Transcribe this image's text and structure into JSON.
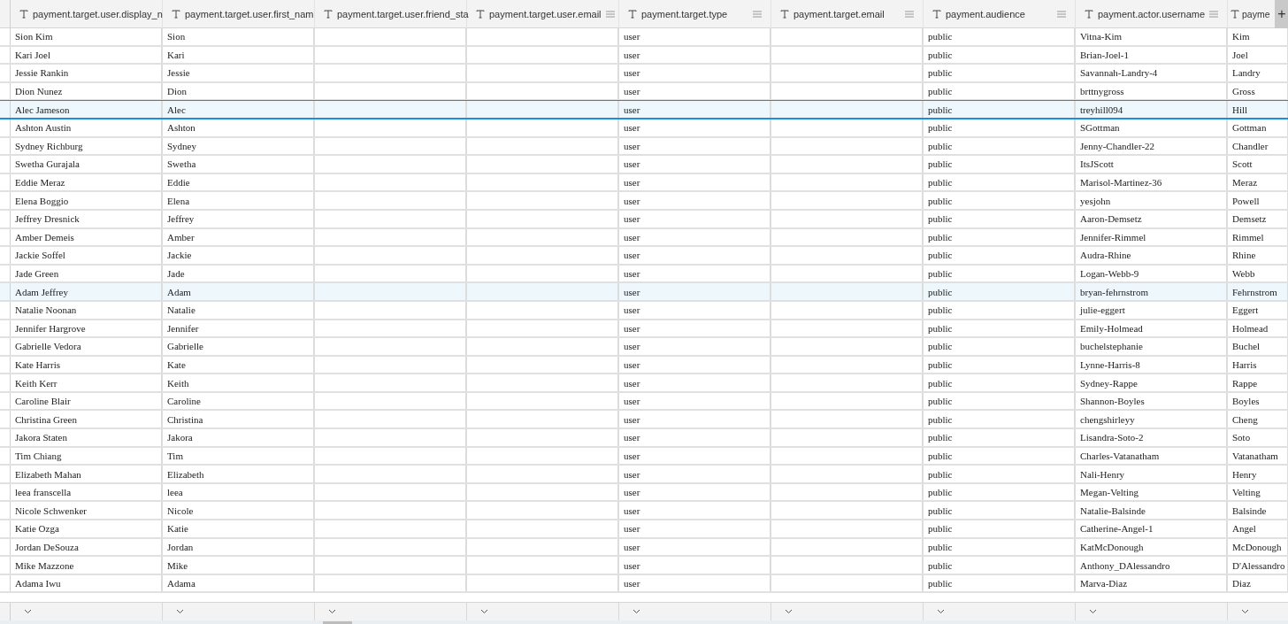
{
  "table": {
    "columns": [
      {
        "label": "payment.target.user.display_n"
      },
      {
        "label": "payment.target.user.first_nam"
      },
      {
        "label": "payment.target.user.friend_sta"
      },
      {
        "label": "payment.target.user.email",
        "menu": true
      },
      {
        "label": "payment.target.type",
        "menu": true
      },
      {
        "label": "payment.target.email",
        "menu": true
      },
      {
        "label": "payment.audience",
        "menu": true
      },
      {
        "label": "payment.actor.username",
        "menu": true
      },
      {
        "label": "payme"
      }
    ],
    "add_column": {
      "label": "+"
    },
    "rows": [
      {
        "display_name": "Sion Kim",
        "first_name": "Sion",
        "target_type": "user",
        "audience": "public",
        "actor_username": "Vitna-Kim",
        "column_9": "Kim",
        "selected": false,
        "highlighted": false
      },
      {
        "display_name": "Kari Joel",
        "first_name": "Kari",
        "target_type": "user",
        "audience": "public",
        "actor_username": "Brian-Joel-1",
        "column_9": "Joel",
        "selected": false,
        "highlighted": false
      },
      {
        "display_name": "Jessie Rankin",
        "first_name": "Jessie",
        "target_type": "user",
        "audience": "public",
        "actor_username": "Savannah-Landry-4",
        "column_9": "Landry",
        "selected": false,
        "highlighted": false
      },
      {
        "display_name": "Dion Nunez",
        "first_name": "Dion",
        "target_type": "user",
        "audience": "public",
        "actor_username": "brttnygross",
        "column_9": "Gross",
        "selected": false,
        "highlighted": false
      },
      {
        "display_name": "Alec Jameson",
        "first_name": "Alec",
        "target_type": "user",
        "audience": "public",
        "actor_username": "treyhill094",
        "column_9": "Hill",
        "selected": true,
        "highlighted": true
      },
      {
        "display_name": "Ashton Austin",
        "first_name": "Ashton",
        "target_type": "user",
        "audience": "public",
        "actor_username": "SGottman",
        "column_9": "Gottman",
        "selected": false,
        "highlighted": false
      },
      {
        "display_name": "Sydney Richburg",
        "first_name": "Sydney",
        "target_type": "user",
        "audience": "public",
        "actor_username": "Jenny-Chandler-22",
        "column_9": "Chandler",
        "selected": false,
        "highlighted": false
      },
      {
        "display_name": "Swetha Gurajala",
        "first_name": "Swetha",
        "target_type": "user",
        "audience": "public",
        "actor_username": "ItsJScott",
        "column_9": "Scott",
        "selected": false,
        "highlighted": false
      },
      {
        "display_name": "Eddie Meraz",
        "first_name": "Eddie",
        "target_type": "user",
        "audience": "public",
        "actor_username": "Marisol-Martinez-36",
        "column_9": "Meraz",
        "selected": false,
        "highlighted": false
      },
      {
        "display_name": "Elena Boggio",
        "first_name": "Elena",
        "target_type": "user",
        "audience": "public",
        "actor_username": "yesjohn",
        "column_9": "Powell",
        "selected": false,
        "highlighted": false
      },
      {
        "display_name": "Jeffrey Dresnick",
        "first_name": "Jeffrey",
        "target_type": "user",
        "audience": "public",
        "actor_username": "Aaron-Demsetz",
        "column_9": "Demsetz",
        "selected": false,
        "highlighted": false
      },
      {
        "display_name": "Amber Demeis",
        "first_name": "Amber",
        "target_type": "user",
        "audience": "public",
        "actor_username": "Jennifer-Rimmel",
        "column_9": "Rimmel",
        "selected": false,
        "highlighted": false
      },
      {
        "display_name": "Jackie Soffel",
        "first_name": "Jackie",
        "target_type": "user",
        "audience": "public",
        "actor_username": "Audra-Rhine",
        "column_9": "Rhine",
        "selected": false,
        "highlighted": false
      },
      {
        "display_name": "Jade Green",
        "first_name": "Jade",
        "target_type": "user",
        "audience": "public",
        "actor_username": "Logan-Webb-9",
        "column_9": "Webb",
        "selected": false,
        "highlighted": false
      },
      {
        "display_name": "Adam Jeffrey",
        "first_name": "Adam",
        "target_type": "user",
        "audience": "public",
        "actor_username": "bryan-fehrnstrom",
        "column_9": "Fehrnstrom",
        "selected": false,
        "highlighted": true
      },
      {
        "display_name": "Natalie Noonan",
        "first_name": "Natalie",
        "target_type": "user",
        "audience": "public",
        "actor_username": "julie-eggert",
        "column_9": "Eggert",
        "selected": false,
        "highlighted": false
      },
      {
        "display_name": "Jennifer Hargrove",
        "first_name": "Jennifer",
        "target_type": "user",
        "audience": "public",
        "actor_username": "Emily-Holmead",
        "column_9": "Holmead",
        "selected": false,
        "highlighted": false
      },
      {
        "display_name": "Gabrielle Vedora",
        "first_name": "Gabrielle",
        "target_type": "user",
        "audience": "public",
        "actor_username": "buchelstephanie",
        "column_9": "Buchel",
        "selected": false,
        "highlighted": false
      },
      {
        "display_name": "Kate Harris",
        "first_name": "Kate",
        "target_type": "user",
        "audience": "public",
        "actor_username": "Lynne-Harris-8",
        "column_9": "Harris",
        "selected": false,
        "highlighted": false
      },
      {
        "display_name": "Keith Kerr",
        "first_name": "Keith",
        "target_type": "user",
        "audience": "public",
        "actor_username": "Sydney-Rappe",
        "column_9": "Rappe",
        "selected": false,
        "highlighted": false
      },
      {
        "display_name": "Caroline Blair",
        "first_name": "Caroline",
        "target_type": "user",
        "audience": "public",
        "actor_username": "Shannon-Boyles",
        "column_9": "Boyles",
        "selected": false,
        "highlighted": false
      },
      {
        "display_name": "Christina Green",
        "first_name": "Christina",
        "target_type": "user",
        "audience": "public",
        "actor_username": "chengshirleyy",
        "column_9": "Cheng",
        "selected": false,
        "highlighted": false
      },
      {
        "display_name": "Jakora Staten",
        "first_name": "Jakora",
        "target_type": "user",
        "audience": "public",
        "actor_username": "Lisandra-Soto-2",
        "column_9": "Soto",
        "selected": false,
        "highlighted": false
      },
      {
        "display_name": "Tim Chiang",
        "first_name": "Tim",
        "target_type": "user",
        "audience": "public",
        "actor_username": "Charles-Vatanatham",
        "column_9": "Vatanatham",
        "selected": false,
        "highlighted": false
      },
      {
        "display_name": "Elizabeth Mahan",
        "first_name": "Elizabeth",
        "target_type": "user",
        "audience": "public",
        "actor_username": "Nali-Henry",
        "column_9": "Henry",
        "selected": false,
        "highlighted": false
      },
      {
        "display_name": "leea franscella",
        "first_name": "leea",
        "target_type": "user",
        "audience": "public",
        "actor_username": "Megan-Velting",
        "column_9": "Velting",
        "selected": false,
        "highlighted": false
      },
      {
        "display_name": "Nicole Schwenker",
        "first_name": "Nicole",
        "target_type": "user",
        "audience": "public",
        "actor_username": "Natalie-Balsinde",
        "column_9": "Balsinde",
        "selected": false,
        "highlighted": false
      },
      {
        "display_name": "Katie Ozga",
        "first_name": "Katie",
        "target_type": "user",
        "audience": "public",
        "actor_username": "Catherine-Angel-1",
        "column_9": "Angel",
        "selected": false,
        "highlighted": false
      },
      {
        "display_name": "Jordan DeSouza",
        "first_name": "Jordan",
        "target_type": "user",
        "audience": "public",
        "actor_username": "KatMcDonough",
        "column_9": "McDonough",
        "selected": false,
        "highlighted": false
      },
      {
        "display_name": "Mike Mazzone",
        "first_name": "Mike",
        "target_type": "user",
        "audience": "public",
        "actor_username": "Anthony_DAlessandro",
        "column_9": "D'Alessandro",
        "selected": false,
        "highlighted": false
      },
      {
        "display_name": "Adama Iwu",
        "first_name": "Adama",
        "target_type": "user",
        "audience": "public",
        "actor_username": "Marva-Diaz",
        "column_9": "Diaz",
        "selected": false,
        "highlighted": false
      }
    ]
  }
}
